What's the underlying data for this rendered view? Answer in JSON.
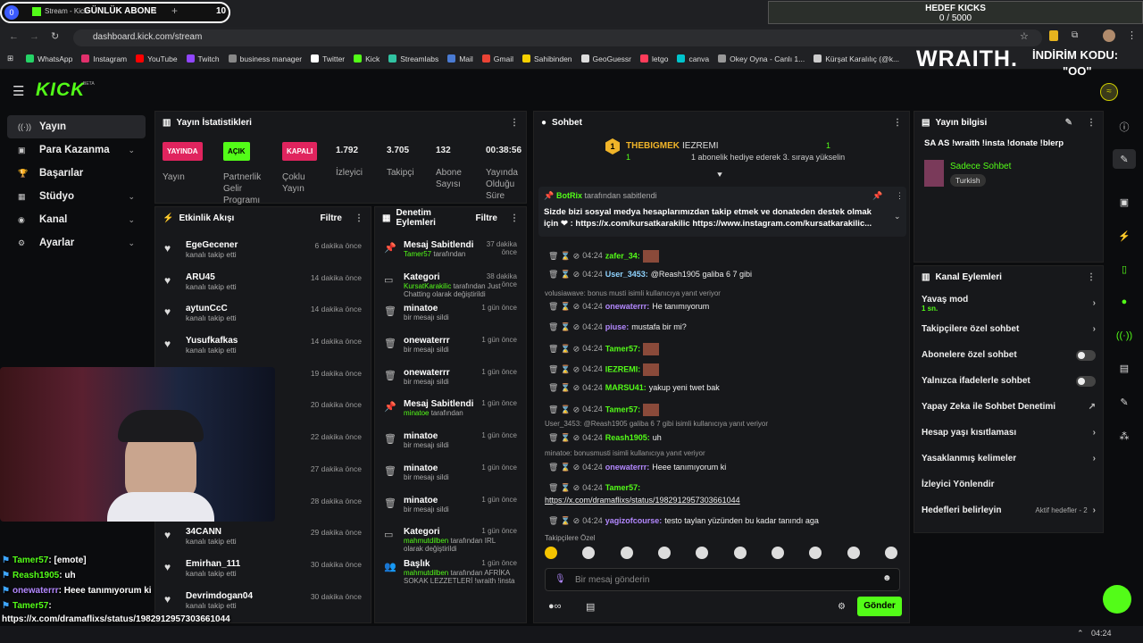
{
  "goal": {
    "label": "GÜNLÜK ABONE",
    "value": "10",
    "hedef_title": "HEDEF KICKS",
    "hedef_value": "0 / 5000"
  },
  "browser": {
    "tab": "Stream - Kick",
    "url": "dashboard.kick.com/stream",
    "bookmarks": [
      "WhatsApp",
      "Instagram",
      "YouTube",
      "Twitch",
      "business manager",
      "Twitter",
      "Kick",
      "Streamlabs",
      "Mail",
      "Gmail",
      "Sahibinden",
      "GeoGuessr",
      "letgo",
      "canva",
      "Okey Oyna - Canlı 1...",
      "Kürşat Karalılıç (@k..."
    ]
  },
  "overlay": {
    "brand": "WRAITH.",
    "promo": "İNDİRİM KODU:",
    "code": "\"OO\""
  },
  "logo": "KICK",
  "logo_beta": "BETA",
  "nav": [
    {
      "label": "Yayın",
      "icon": "((·))"
    },
    {
      "label": "Para Kazanma",
      "icon": "▣",
      "chev": "⌄"
    },
    {
      "label": "Başarılar",
      "icon": "🏆"
    },
    {
      "label": "Stüdyo",
      "icon": "▦",
      "chev": "⌄"
    },
    {
      "label": "Kanal",
      "icon": "◉",
      "chev": "⌄"
    },
    {
      "label": "Ayarlar",
      "icon": "⚙",
      "chev": "⌄"
    }
  ],
  "stats": {
    "title": "Yayın İstatistikleri",
    "live_badge": "YAYINDA",
    "live_label": "Yayın",
    "open_badge": "AÇIK",
    "open_label": "Partnerlik Gelir Programı",
    "closed_badge": "KAPALI",
    "closed_label": "Çoklu Yayın",
    "viewers": "1.792",
    "viewers_label": "İzleyici",
    "followers": "3.705",
    "followers_label": "Takipçi",
    "subs": "132",
    "subs_label": "Abone Sayısı",
    "uptime": "00:38:56",
    "uptime_label": "Yayında Olduğu Süre"
  },
  "activity": {
    "title": "Etkinlik Akışı",
    "filter": "Filtre",
    "items": [
      {
        "name": "EgeGecener",
        "sub": "kanalı takip etti",
        "time": "6 dakika önce"
      },
      {
        "name": "ARU45",
        "sub": "kanalı takip etti",
        "time": "14 dakika önce"
      },
      {
        "name": "aytunCcC",
        "sub": "kanalı takip etti",
        "time": "14 dakika önce"
      },
      {
        "name": "Yusufkafkas",
        "sub": "kanalı takip etti",
        "time": "14 dakika önce"
      },
      {
        "name": "",
        "sub": "",
        "time": "19 dakika önce"
      },
      {
        "name": "",
        "sub": "",
        "time": "20 dakika önce"
      },
      {
        "name": "",
        "sub": "",
        "time": "22 dakika önce"
      },
      {
        "name": "",
        "sub": "",
        "time": "27 dakika önce"
      },
      {
        "name": "",
        "sub": "",
        "time": "28 dakika önce"
      },
      {
        "name": "34CANN",
        "sub": "kanalı takip etti",
        "time": "29 dakika önce"
      },
      {
        "name": "Emirhan_111",
        "sub": "kanalı takip etti",
        "time": "30 dakika önce"
      },
      {
        "name": "Devrimdogan04",
        "sub": "kanalı takip etti",
        "time": "30 dakika önce"
      }
    ]
  },
  "mod": {
    "title": "Denetim Eylemleri",
    "filter": "Filtre",
    "items": [
      {
        "icon": "📌",
        "name": "Mesaj Sabitlendi",
        "sub_g": "Tamer57",
        "sub": " tarafından",
        "time": "37 dakika önce"
      },
      {
        "icon": "▭",
        "name": "Kategori",
        "sub_g": "KursatKarakilic",
        "sub": " tarafından Just Chatting olarak değiştirildi",
        "time": "38 dakika önce"
      },
      {
        "icon": "🗑",
        "name": "minatoe",
        "sub_g": "",
        "sub": "bir mesajı sildi",
        "time": "1 gün önce"
      },
      {
        "icon": "🗑",
        "name": "onewaterrr",
        "sub_g": "",
        "sub": "bir mesajı sildi",
        "time": "1 gün önce"
      },
      {
        "icon": "🗑",
        "name": "onewaterrr",
        "sub_g": "",
        "sub": "bir mesajı sildi",
        "time": "1 gün önce"
      },
      {
        "icon": "📌",
        "name": "Mesaj Sabitlendi",
        "sub_g": "minatoe",
        "sub": " tarafından",
        "time": "1 gün önce"
      },
      {
        "icon": "🗑",
        "name": "minatoe",
        "sub_g": "",
        "sub": "bir mesajı sildi",
        "time": "1 gün önce"
      },
      {
        "icon": "🗑",
        "name": "minatoe",
        "sub_g": "",
        "sub": "bir mesajı sildi",
        "time": "1 gün önce"
      },
      {
        "icon": "🗑",
        "name": "minatoe",
        "sub_g": "",
        "sub": "bir mesajı sildi",
        "time": "1 gün önce"
      },
      {
        "icon": "▭",
        "name": "Kategori",
        "sub_g": "mahmutdilben",
        "sub": " tarafından IRL olarak değiştirildi",
        "time": "1 gün önce"
      },
      {
        "icon": "👥",
        "name": "Başlık",
        "sub_g": "mahmutdilben",
        "sub": " tarafından AFRİKA SOKAK LEZZETLERİ !wraith !insta",
        "time": "1 gün önce"
      }
    ]
  },
  "chat": {
    "title": "Sohbet",
    "top_user": "THEBIGMEK",
    "top_count": "1",
    "gift_user": "IEZREMI",
    "gift_count": "1",
    "gift_text": "1 abonelik hediye ederek 3. sıraya yükselin",
    "pinned_by": "BotRix",
    "pinned_label": "tarafından sabitlendi",
    "pinned_text": "Sizde bizi sosyal medya hesaplarımızdan takip etmek ve donateden destek olmak için ❤ : https://x.com/kursatkarakilic https://www.instagram.com/kursatkarakilic...",
    "messages": [
      {
        "time": "04:24",
        "user": "zafer_34:",
        "color": "#53fc18",
        "text": "[emote]"
      },
      {
        "time": "04:24",
        "user": "User_3453:",
        "color": "#8fd3ff",
        "text": "@Reash1905 galiba 6 7 gibi"
      },
      {
        "reply": "volusiawave: bonus musti isimli kullanıcıya yanıt veriyor"
      },
      {
        "time": "04:24",
        "user": "onewaterrr:",
        "color": "#b388ff",
        "text": "He tanımıyorum"
      },
      {
        "time": "04:24",
        "user": "piuse:",
        "color": "#b388ff",
        "text": "mustafa bir mi?"
      },
      {
        "time": "04:24",
        "user": "Tamer57:",
        "color": "#53fc18",
        "text": "[emote]"
      },
      {
        "time": "04:24",
        "user": "IEZREMI:",
        "color": "#53fc18",
        "text": "[emote]"
      },
      {
        "time": "04:24",
        "user": "MARSU41:",
        "color": "#53fc18",
        "text": "yakup yeni twet bak"
      },
      {
        "time": "04:24",
        "user": "Tamer57:",
        "color": "#53fc18",
        "text": "[emote]"
      },
      {
        "reply": "User_3453: @Reash1905 galiba 6 7 gibi isimli kullanıcıya yanıt veriyor"
      },
      {
        "time": "04:24",
        "user": "Reash1905:",
        "color": "#53fc18",
        "text": "uh"
      },
      {
        "reply": "minatoe: bonusmusti isimli kullanıcıya yanıt veriyor"
      },
      {
        "time": "04:24",
        "user": "onewaterrr:",
        "color": "#b388ff",
        "text": "Heee tanımıyorum ki"
      },
      {
        "time": "04:24",
        "user": "Tamer57:",
        "color": "#53fc18",
        "text": ""
      },
      {
        "link": "https://x.com/dramaflixs/status/1982912957303661044"
      },
      {
        "time": "04:24",
        "user": "yagizofcourse:",
        "color": "#b388ff",
        "text": "testo taylan yüzünden bu kadar tanındı aga"
      }
    ],
    "followers_only": "Takipçilere Özel",
    "placeholder": "Bir mesaj gönderin",
    "send": "Gönder"
  },
  "info": {
    "title": "Yayın bilgisi",
    "stream_title": "SA AS !wraith !insta !donate !blerp",
    "category": "Sadece Sohbet",
    "language": "Turkish"
  },
  "actions": {
    "title": "Kanal Eylemleri",
    "items": [
      {
        "label": "Yavaş mod",
        "sub": "1 sn.",
        "type": "chev"
      },
      {
        "label": "Takipçilere özel sohbet",
        "type": "chev"
      },
      {
        "label": "Abonelere özel sohbet",
        "type": "toggle"
      },
      {
        "label": "Yalnızca ifadelerle sohbet",
        "type": "toggle"
      },
      {
        "label": "Yapay Zeka ile Sohbet Denetimi",
        "type": "ext"
      },
      {
        "label": "Hesap yaşı kısıtlaması",
        "type": "chev"
      },
      {
        "label": "Yasaklanmış kelimeler",
        "type": "chev"
      },
      {
        "label": "İzleyici Yönlendir",
        "type": "none"
      },
      {
        "label": "Hedefleri belirleyin",
        "type": "chev",
        "extra": "Aktif hedefler - 2"
      }
    ]
  },
  "overlay_chat": [
    {
      "user": "Tamer57",
      "color": "#53fc18",
      "text": ": [emote]"
    },
    {
      "user": "Reash1905",
      "color": "#53fc18",
      "text": ": uh"
    },
    {
      "user": "onewaterrr",
      "color": "#b388ff",
      "text": ": Heee tanımıyorum ki"
    },
    {
      "user": "Tamer57",
      "color": "#53fc18",
      "text": ":"
    },
    {
      "user": "",
      "color": "#fff",
      "text": "https://x.com/dramaflixs/status/1982912957303661044"
    },
    {
      "user": "yagizofcourse",
      "color": "#b388ff",
      "text": ": testo taylan yüzünden bu kadar tanındı aga"
    }
  ],
  "taskbar": {
    "time": "04:24"
  }
}
